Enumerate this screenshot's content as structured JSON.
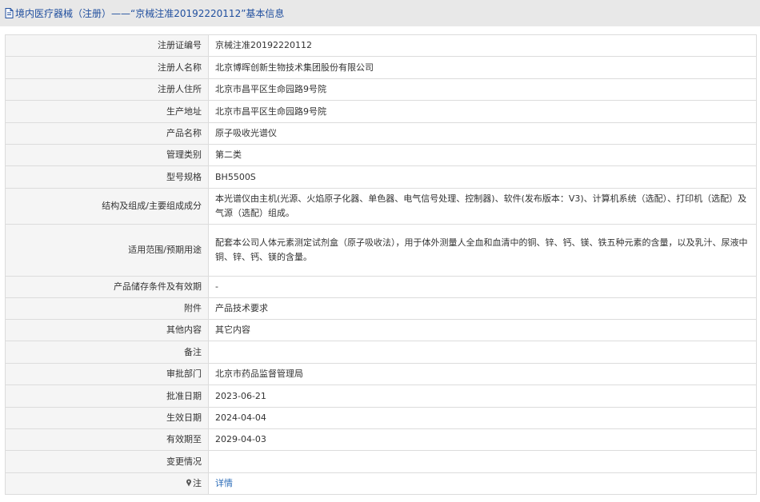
{
  "header": {
    "title": "境内医疗器械（注册）——“京械注准20192220112”基本信息",
    "icon": "document-icon"
  },
  "rows": [
    {
      "label": "注册证编号",
      "value": "京械注准20192220112"
    },
    {
      "label": "注册人名称",
      "value": "北京博晖创新生物技术集团股份有限公司"
    },
    {
      "label": "注册人住所",
      "value": "北京市昌平区生命园路9号院"
    },
    {
      "label": "生产地址",
      "value": "北京市昌平区生命园路9号院"
    },
    {
      "label": "产品名称",
      "value": "原子吸收光谱仪"
    },
    {
      "label": "管理类别",
      "value": "第二类"
    },
    {
      "label": "型号规格",
      "value": "BH5500S"
    },
    {
      "label": "结构及组成/主要组成成分",
      "value": "本光谱仪由主机(光源、火焰原子化器、单色器、电气信号处理、控制器)、软件(发布版本：V3)、计算机系统（选配）、打印机（选配）及气源（选配）组成。"
    },
    {
      "label": "适用范围/预期用途",
      "value": "配套本公司人体元素测定试剂盒（原子吸收法），用于体外测量人全血和血清中的铜、锌、钙、镁、铁五种元素的含量，以及乳汁、尿液中铜、锌、钙、镁的含量。"
    },
    {
      "label": "产品储存条件及有效期",
      "value": "-"
    },
    {
      "label": "附件",
      "value": "产品技术要求"
    },
    {
      "label": "其他内容",
      "value": "其它内容"
    },
    {
      "label": "备注",
      "value": ""
    },
    {
      "label": "审批部门",
      "value": "北京市药品监督管理局"
    },
    {
      "label": "批准日期",
      "value": "2023-06-21"
    },
    {
      "label": "生效日期",
      "value": "2024-04-04"
    },
    {
      "label": "有效期至",
      "value": "2029-04-03"
    },
    {
      "label": "变更情况",
      "value": ""
    },
    {
      "label": "注",
      "value": "详情",
      "icon": "pin-icon"
    }
  ]
}
